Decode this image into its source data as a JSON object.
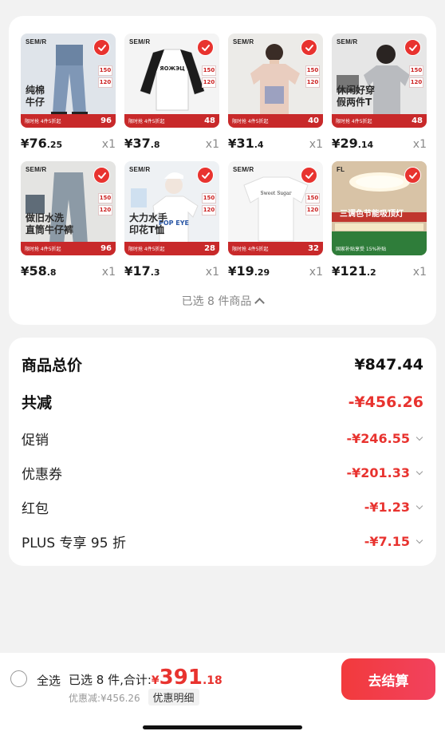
{
  "products": [
    {
      "brand": "SEM/R",
      "overlay": "纯棉\n牛仔",
      "promo": "限时抢 4件5折起",
      "promo_num": "96",
      "price_int": "76",
      "price_dec": ".25",
      "qty": "x1",
      "stickers": [
        "150",
        "120"
      ],
      "bg": "#dfe4ea",
      "garment": "jeans"
    },
    {
      "brand": "SEM/R",
      "overlay": "",
      "promo": "限时抢 4件5折起",
      "promo_num": "48",
      "price_int": "37",
      "price_dec": ".8",
      "qty": "x1",
      "stickers": [
        "150",
        "120"
      ],
      "bg": "#f4f4f4",
      "garment": "raglan"
    },
    {
      "brand": "SEM/R",
      "overlay": "",
      "promo": "限时抢 4件5折起",
      "promo_num": "40",
      "price_int": "31",
      "price_dec": ".4",
      "qty": "x1",
      "stickers": [
        "150",
        "120"
      ],
      "bg": "#ecebe8",
      "garment": "pinktee"
    },
    {
      "brand": "SEM/R",
      "overlay": "休闲好穿\n假两件T",
      "promo": "限时抢 4件5折起",
      "promo_num": "48",
      "price_int": "29",
      "price_dec": ".14",
      "qty": "x1",
      "stickers": [
        "150",
        "120"
      ],
      "bg": "#e6e6e6",
      "garment": "greytee"
    },
    {
      "brand": "SEM/R",
      "overlay": "做旧水洗\n直筒牛仔裤",
      "promo": "限时抢 4件5折起",
      "promo_num": "96",
      "price_int": "58",
      "price_dec": ".8",
      "qty": "x1",
      "stickers": [
        "150",
        "120"
      ],
      "bg": "#e4e4e2",
      "garment": "greyjeans"
    },
    {
      "brand": "SEM/R",
      "overlay": "大力水手\n印花T恤",
      "promo": "限时抢 4件5折起",
      "promo_num": "28",
      "price_int": "17",
      "price_dec": ".3",
      "qty": "x1",
      "stickers": [
        "150",
        "120"
      ],
      "bg": "#eef1f4",
      "garment": "whitetee"
    },
    {
      "brand": "SEM/R",
      "overlay": "",
      "promo": "限时抢 4件5折起",
      "promo_num": "32",
      "price_int": "19",
      "price_dec": ".29",
      "qty": "x1",
      "stickers": [
        "150",
        "120"
      ],
      "bg": "#f6f6f6",
      "garment": "flattee"
    },
    {
      "brand": "FL",
      "overlay": "三调色节能吸顶灯",
      "promo": "国家补贴享受 15%补贴",
      "promo_num": "",
      "price_int": "121",
      "price_dec": ".2",
      "qty": "x1",
      "stickers": [],
      "bg": "#d9c9b2",
      "garment": "lamp"
    }
  ],
  "currency": "¥",
  "selected_summary": "已选 8 件商品",
  "summary": {
    "total_label": "商品总价",
    "total_value": "¥847.44",
    "reduction_label": "共减",
    "reduction_value": "-¥456.26",
    "promo_label": "促销",
    "promo_value": "-¥246.55",
    "coupon_label": "优惠券",
    "coupon_value": "-¥201.33",
    "redpacket_label": "红包",
    "redpacket_value": "-¥1.23",
    "plus_label": "PLUS 专享 95 折",
    "plus_value": "-¥7.15"
  },
  "bottom": {
    "select_all": "全选",
    "selected_total": "已选 8 件,合计:",
    "currency": "¥",
    "amount": "391",
    "cents": ".18",
    "discount_text": "优惠减:¥456.26",
    "detail_label": "优惠明细",
    "checkout_label": "去结算"
  },
  "colors": {
    "accent": "#e8332f",
    "promo_band": "#c8292a"
  }
}
